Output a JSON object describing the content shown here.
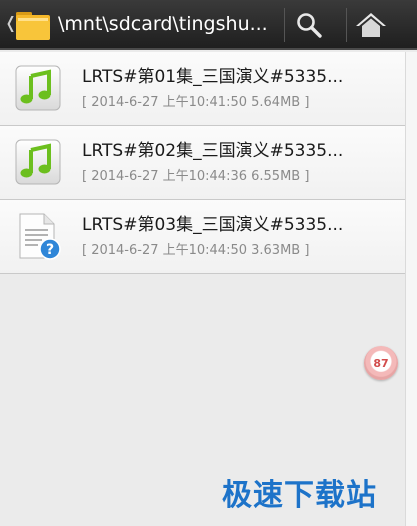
{
  "actionbar": {
    "path": "\\mnt\\sdcard\\tingshu..."
  },
  "files": [
    {
      "name": "LRTS#第01集_三国演义#5335...",
      "meta": "[ 2014-6-27 上午10:41:50 5.64MB ]",
      "type": "audio"
    },
    {
      "name": "LRTS#第02集_三国演义#5335...",
      "meta": "[ 2014-6-27 上午10:44:36 6.55MB ]",
      "type": "audio"
    },
    {
      "name": "LRTS#第03集_三国演义#5335...",
      "meta": "[ 2014-6-27 上午10:44:50 3.63MB ]",
      "type": "unknown"
    }
  ],
  "badge": {
    "value": "87"
  },
  "watermark": {
    "text": "极速下载站"
  },
  "colors": {
    "actionbar": "#2b2b2b",
    "music_green": "#6cbf1e",
    "help_blue": "#2f86d8",
    "watermark": "#1d73c9"
  }
}
